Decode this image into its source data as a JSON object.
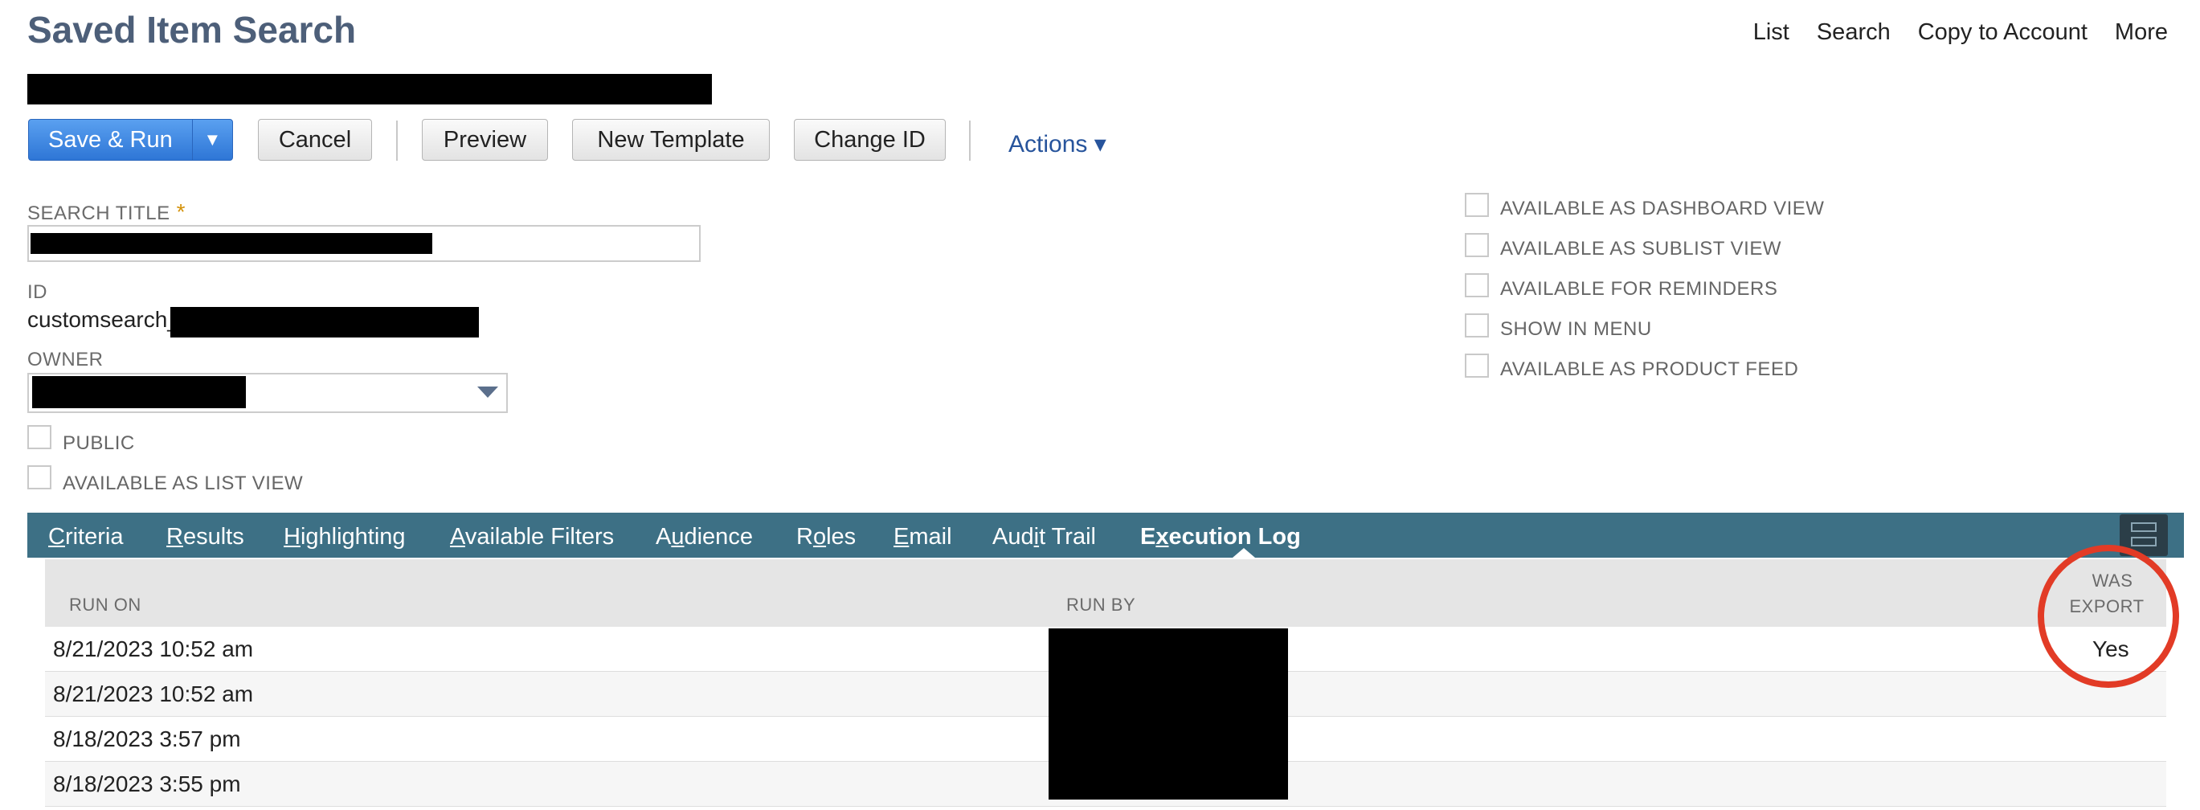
{
  "header": {
    "title": "Saved Item Search",
    "links": [
      "List",
      "Search",
      "Copy to Account",
      "More"
    ]
  },
  "toolbar": {
    "save_run": "Save & Run",
    "save_run_dropdown": "▼",
    "cancel": "Cancel",
    "preview": "Preview",
    "new_template": "New Template",
    "change_id": "Change ID",
    "actions": "Actions ▾"
  },
  "form": {
    "search_title_label": "SEARCH TITLE",
    "required_mark": "*",
    "id_label": "ID",
    "id_value": "customsearch_",
    "owner_label": "OWNER",
    "public_label": "PUBLIC",
    "list_view_label": "AVAILABLE AS LIST VIEW",
    "right_checkboxes": [
      "AVAILABLE AS DASHBOARD VIEW",
      "AVAILABLE AS SUBLIST VIEW",
      "AVAILABLE FOR REMINDERS",
      "SHOW IN MENU",
      "AVAILABLE AS PRODUCT FEED"
    ]
  },
  "tabs": [
    {
      "label": "Criteria",
      "u": "C"
    },
    {
      "label": "Results",
      "u": "R"
    },
    {
      "label": "Highlighting",
      "u": "H"
    },
    {
      "label": "Available Filters",
      "u": "A"
    },
    {
      "label": "Audience",
      "u": "u"
    },
    {
      "label": "Roles",
      "u": "o"
    },
    {
      "label": "Email",
      "u": "E"
    },
    {
      "label": "Audit Trail",
      "u": "i"
    },
    {
      "label": "Execution Log",
      "u": "x",
      "active": true
    }
  ],
  "execution_log": {
    "columns": {
      "run_on": "RUN ON",
      "run_by": "RUN BY",
      "was_export_1": "WAS",
      "was_export_2": "EXPORT"
    },
    "rows": [
      {
        "run_on": "8/21/2023 10:52 am",
        "was_export": "Yes"
      },
      {
        "run_on": "8/21/2023 10:52 am",
        "was_export": ""
      },
      {
        "run_on": "8/18/2023 3:57 pm",
        "was_export": ""
      },
      {
        "run_on": "8/18/2023 3:55 pm",
        "was_export": ""
      }
    ]
  },
  "colors": {
    "title": "#4d5f79",
    "primary_button": "#2e76d6",
    "tab_bar": "#3d7085",
    "link": "#27549c",
    "highlight_circle": "#e23b26"
  }
}
